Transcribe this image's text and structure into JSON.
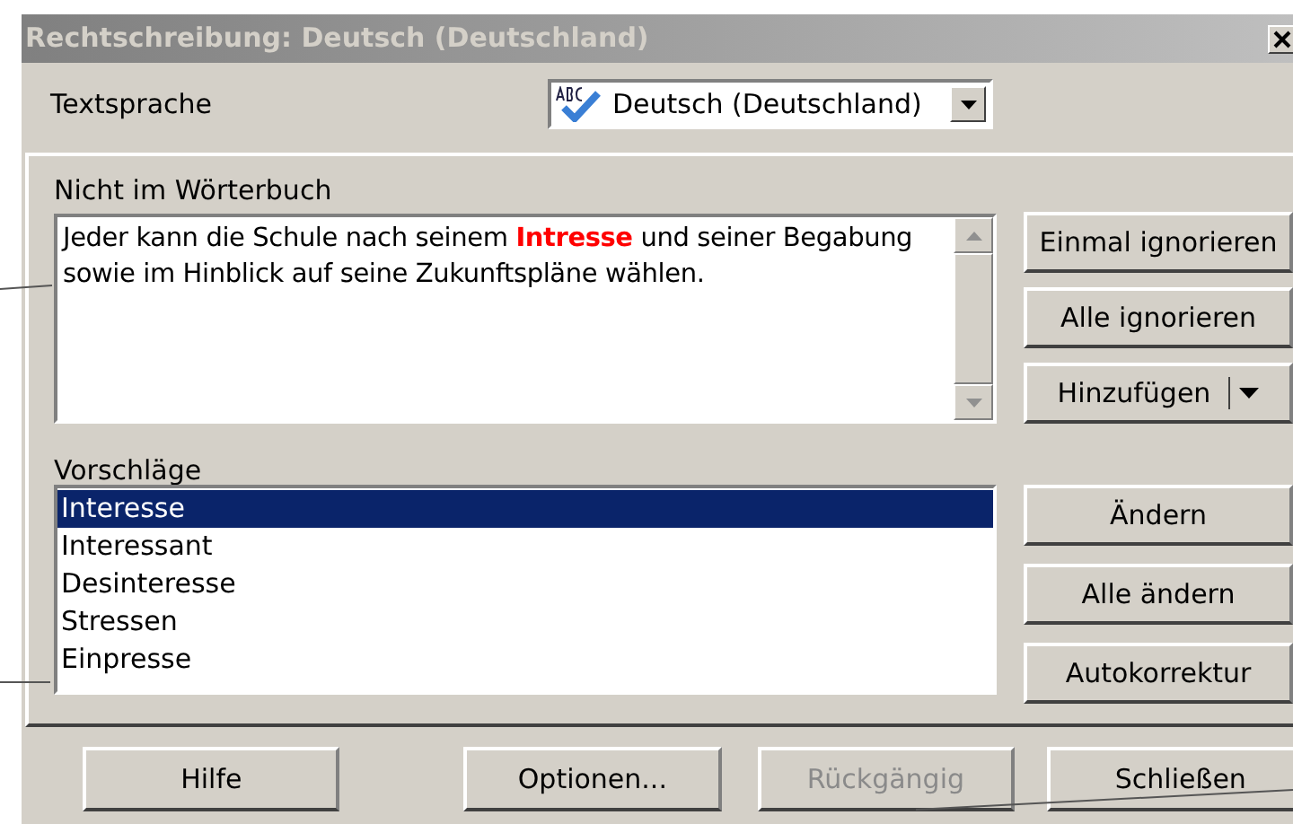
{
  "window": {
    "title": "Rechtschreibung: Deutsch (Deutschland)"
  },
  "language": {
    "label": "Textsprache",
    "value": "Deutsch (Deutschland)"
  },
  "not_in_dictionary": {
    "label": "Nicht im Wörterbuch",
    "text": "Jeder kann die Schule nach seinem **Intresse** und seiner Begabung sowie im Hinblick auf seine Zukunftspläne wählen."
  },
  "side_buttons": [
    {
      "label": "Einmal ignorieren",
      "has_menu": false
    },
    {
      "label": "Alle ignorieren",
      "has_menu": false
    },
    {
      "label": "Hinzufügen",
      "has_menu": true
    }
  ],
  "suggestions": {
    "label": "Vorschläge",
    "items": [
      {
        "text": "Interesse",
        "selected": true
      },
      {
        "text": "Interessant",
        "selected": false
      },
      {
        "text": "Desinteresse",
        "selected": false
      },
      {
        "text": "Stressen",
        "selected": false
      },
      {
        "text": "Einpresse",
        "selected": false
      }
    ]
  },
  "suggestion_buttons": [
    {
      "label": "Ändern"
    },
    {
      "label": "Alle ändern"
    },
    {
      "label": "Autokorrektur"
    }
  ],
  "bottom_buttons": [
    {
      "label": "Hilfe",
      "disabled": false
    },
    {
      "label": "Optionen...",
      "disabled": false
    },
    {
      "label": "Rückgängig",
      "disabled": true
    },
    {
      "label": "Schließen",
      "disabled": false
    }
  ]
}
